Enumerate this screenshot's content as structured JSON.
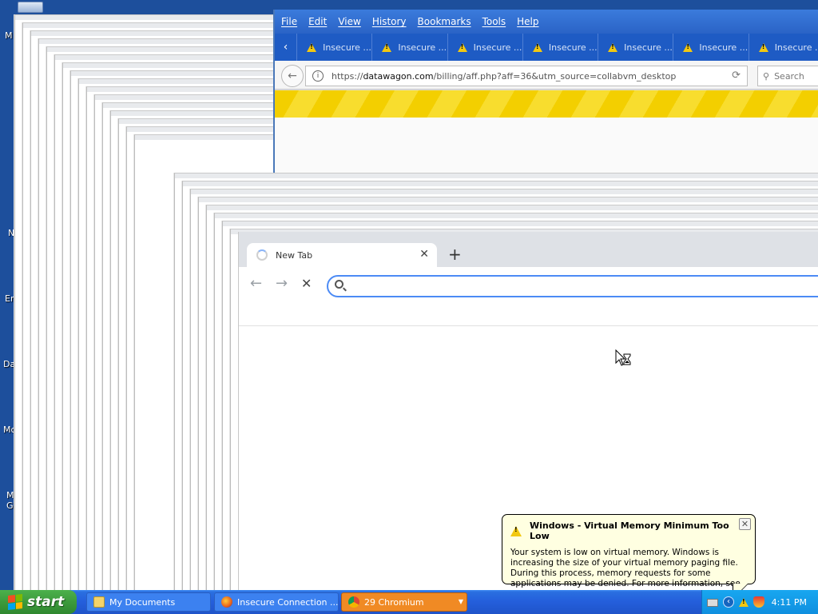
{
  "desktop": {
    "icon_labels": [
      "M",
      "N",
      "Er",
      "Da",
      "Mc",
      "M",
      "G"
    ]
  },
  "firefox": {
    "menu": [
      "File",
      "Edit",
      "View",
      "History",
      "Bookmarks",
      "Tools",
      "Help"
    ],
    "tabs": [
      "Insecure ...",
      "Insecure ...",
      "Insecure ...",
      "Insecure ...",
      "Insecure ...",
      "Insecure ...",
      "Insecure ..."
    ],
    "url_prefix": "https://",
    "url_domain": "datawagon.com",
    "url_path": "/billing/aff.php?aff=36&utm_source=collabvm_desktop",
    "search_placeholder": "Search",
    "banner_color": "#f3cf00"
  },
  "chromium": {
    "tab_title": "New Tab",
    "new_tab_symbol": "+",
    "close_symbol": "✕",
    "back_symbol": "←",
    "forward_symbol": "→",
    "stop_symbol": "✕",
    "omnibox_value": ""
  },
  "balloon": {
    "title": "Windows - Virtual Memory Minimum Too Low",
    "text": "Your system is low on virtual memory. Windows is increasing the size of your virtual memory paging file. During this process, memory requests for some applications may be denied. For more information, see Help.",
    "close_symbol": "✕"
  },
  "taskbar": {
    "start_label": "start",
    "buttons": [
      {
        "label": "My Documents"
      },
      {
        "label": "Insecure Connection ..."
      },
      {
        "label": "29 Chromium"
      }
    ],
    "clock": "4:11 PM"
  }
}
